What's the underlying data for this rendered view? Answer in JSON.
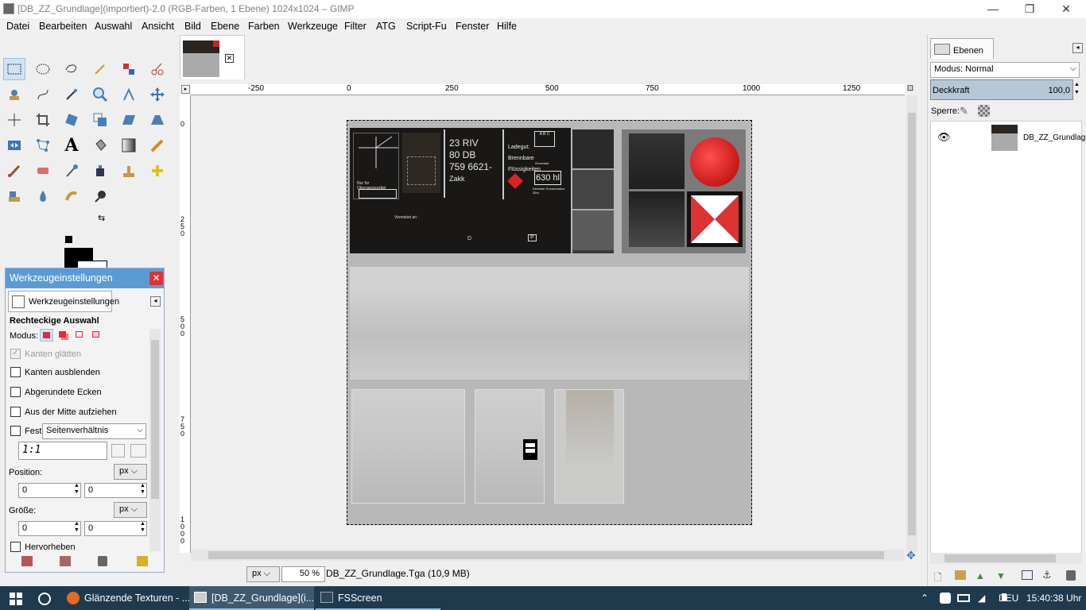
{
  "window": {
    "title": "[DB_ZZ_Grundlage](importiert)-2.0 (RGB-Farben, 1 Ebene) 1024x1024 – GIMP"
  },
  "menu": [
    "Datei",
    "Bearbeiten",
    "Auswahl",
    "Ansicht",
    "Bild",
    "Ebene",
    "Farben",
    "Werkzeuge",
    "Filter",
    "ATG",
    "Script-Fu",
    "Fenster",
    "Hilfe"
  ],
  "tool_options": {
    "panel_title": "Werkzeugeinstellungen",
    "tab_label": "Werkzeugeinstellungen",
    "tool_name": "Rechteckige Auswahl",
    "modus_label": "Modus:",
    "antialias": "Kanten glätten",
    "feather": "Kanten ausblenden",
    "rounded": "Abgerundete Ecken",
    "from_center": "Aus der Mitte aufziehen",
    "fixed_label": "Fest:",
    "fixed_value": "Seitenverhältnis",
    "ratio": "1:1",
    "position_label": "Position:",
    "position_unit": "px",
    "pos_x": "0",
    "pos_y": "0",
    "size_label": "Größe:",
    "size_unit": "px",
    "size_x": "0",
    "size_y": "0",
    "highlight": "Hervorheben"
  },
  "ruler": {
    "top": [
      "-250",
      "0",
      "250",
      "500",
      "750",
      "1000",
      "1250"
    ],
    "left": [
      "0",
      "250",
      "500",
      "750",
      "1000"
    ]
  },
  "texture": {
    "labels": {
      "car_no_1": "23 RIV",
      "car_no_2": "80 DB",
      "car_no_3": "759 6621-",
      "car_type": "Zakk",
      "ladegut": "Ladegut:",
      "brennbare": "Brennbare",
      "fluessig": "Flüssigkeiten",
      "volume": "630 hl",
      "vermietet": "Vermietet an :",
      "d_mark": "D",
      "p_mark": "P",
      "nur_fuer": "Nur für Übergangszettel",
      "abc": "A B C",
      "grenz": "Grenzlast",
      "min_radius": "Kleinster Kurvenradius 35m"
    }
  },
  "status": {
    "unit": "px",
    "zoom": "50 %",
    "filename": "DB_ZZ_Grundlage.Tga (10,9 MB)"
  },
  "layers": {
    "tab": "Ebenen",
    "mode_label": "Modus: Normal",
    "opacity_label": "Deckkraft",
    "opacity_value": "100,0",
    "lock_label": "Sperre:",
    "layer_name": "DB_ZZ_Grundlag"
  },
  "taskbar": {
    "item1": "Glänzende Texturen - ...",
    "item2": "[DB_ZZ_Grundlage](i...",
    "item3": "FSScreen",
    "lang": "DEU",
    "time": "15:40:38 Uhr"
  }
}
